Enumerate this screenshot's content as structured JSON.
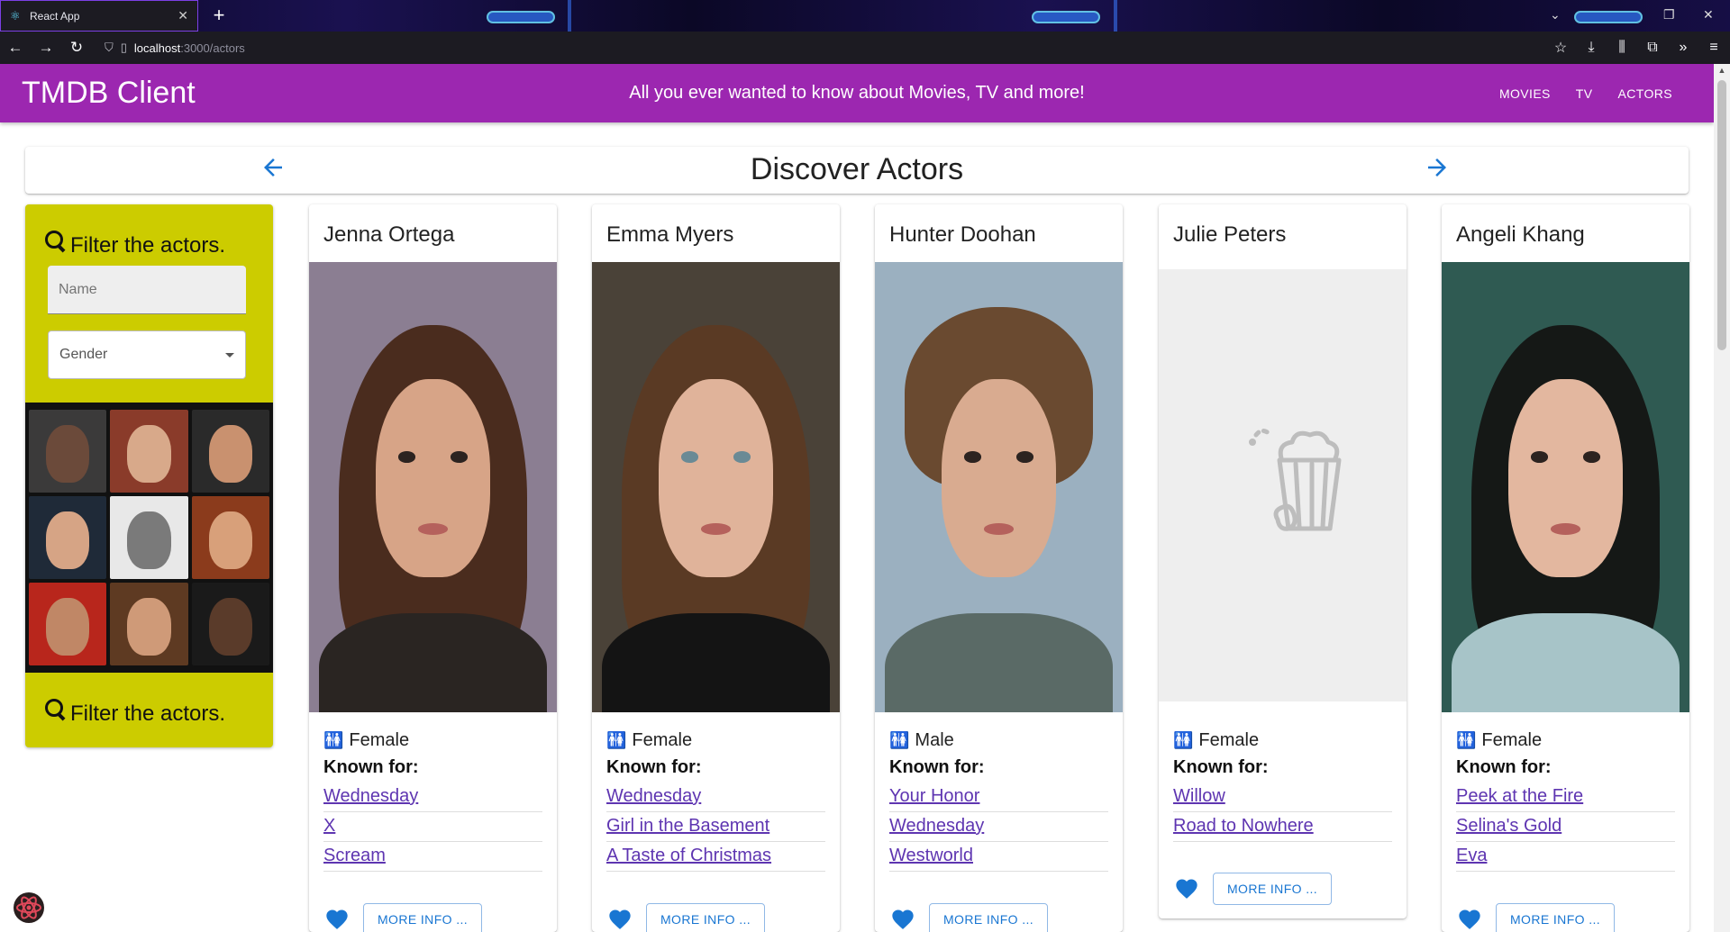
{
  "browser": {
    "tab_title": "React App",
    "url_host": "localhost",
    "url_path": ":3000/actors",
    "new_tab": "+",
    "tab_close": "✕"
  },
  "app": {
    "title": "TMDB Client",
    "tagline": "All you ever wanted to know about Movies, TV and more!",
    "menu": [
      "MOVIES",
      "TV",
      "ACTORS"
    ],
    "brand_color": "#9c27b0"
  },
  "header": {
    "title": "Discover Actors"
  },
  "filter": {
    "title": "Filter the actors.",
    "name_placeholder": "Name",
    "gender_label": "Gender",
    "footer_title": "Filter the actors.",
    "background": "#cccc00"
  },
  "actors": [
    {
      "name": "Jenna Ortega",
      "gender": "Female",
      "known_label": "Known for:",
      "known_for": [
        "Wednesday",
        "X",
        "Scream"
      ],
      "more_label": "MORE INFO ..."
    },
    {
      "name": "Emma Myers",
      "gender": "Female",
      "known_label": "Known for:",
      "known_for": [
        "Wednesday",
        "Girl in the Basement",
        "A Taste of Christmas"
      ],
      "more_label": "MORE INFO ..."
    },
    {
      "name": "Hunter Doohan",
      "gender": "Male",
      "known_label": "Known for:",
      "known_for": [
        "Your Honor",
        "Wednesday",
        "Westworld"
      ],
      "more_label": "MORE INFO ..."
    },
    {
      "name": "Julie Peters",
      "gender": "Female",
      "known_label": "Known for:",
      "known_for": [
        "Willow",
        "Road to Nowhere"
      ],
      "more_label": "MORE INFO ..."
    },
    {
      "name": "Angeli Khang",
      "gender": "Female",
      "known_label": "Known for:",
      "known_for": [
        "Peek at the Fire",
        "Selina's Gold",
        "Eva"
      ],
      "more_label": "MORE INFO ..."
    }
  ],
  "icons": {
    "back": "←",
    "forward": "→",
    "reload": "↻",
    "prev_page": "🡐",
    "next_page": "🡒",
    "gender": "👫",
    "favorite": "heart-icon"
  }
}
